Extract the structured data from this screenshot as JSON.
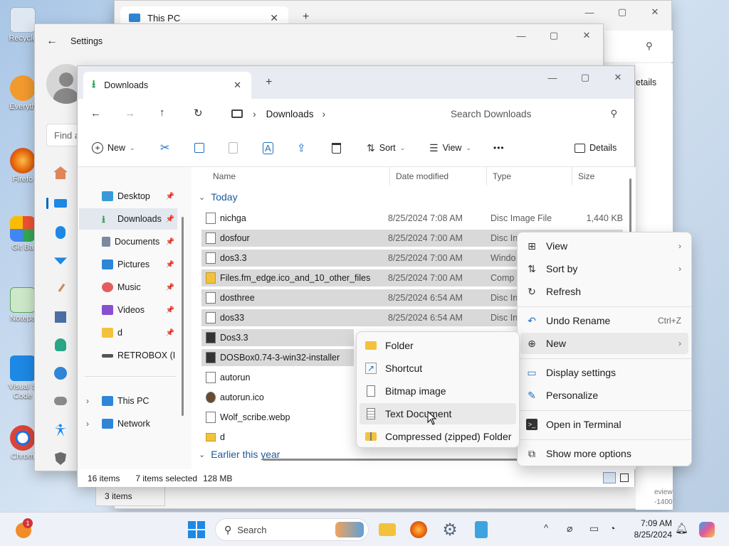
{
  "desktop": {
    "icons": [
      {
        "label": "Recycle",
        "color": "#4a90d9"
      },
      {
        "label": "Everyth",
        "color": "#f29a2e"
      },
      {
        "label": "Firefo",
        "color": "#e66000"
      },
      {
        "label": "Git Ba",
        "color": "#f05133"
      },
      {
        "label": "Notepa",
        "color": "#58a55c"
      },
      {
        "label": "Visual S Code",
        "color": "#1e88e5"
      },
      {
        "label": "Chrom",
        "color": "#1a73e8"
      }
    ]
  },
  "back_window": {
    "tab_title": "This PC",
    "search_icon": "search-icon",
    "details_label": "etails",
    "status_items": "3 items",
    "watermark_1": "eview",
    "watermark_2": "-1400"
  },
  "settings": {
    "title": "Settings",
    "search_placeholder": "Find a"
  },
  "explorer": {
    "tab_title": "Downloads",
    "address": {
      "folder": "Downloads"
    },
    "search_placeholder": "Search Downloads",
    "toolbar": {
      "new_label": "New",
      "sort_label": "Sort",
      "view_label": "View",
      "more_label": "•••",
      "details_label": "Details"
    },
    "sidebar": {
      "quick_access": [
        {
          "label": "Desktop",
          "color": "#3a9ad9"
        },
        {
          "label": "Downloads",
          "color": "#2e9e5b"
        },
        {
          "label": "Documents",
          "color": "#7a8aa0"
        },
        {
          "label": "Pictures",
          "color": "#2f86d6"
        },
        {
          "label": "Music",
          "color": "#e45d5d"
        },
        {
          "label": "Videos",
          "color": "#8a4fd1"
        },
        {
          "label": "d",
          "color": "#f3c23c"
        },
        {
          "label": "RETROBOX (I",
          "color": "#555555"
        }
      ],
      "this_pc": "This PC",
      "network": "Network"
    },
    "columns": {
      "name": "Name",
      "date": "Date modified",
      "type": "Type",
      "size": "Size"
    },
    "groups": {
      "today": "Today",
      "earlier": "Earlier this year"
    },
    "files": [
      {
        "name": "nichga",
        "date": "8/25/2024 7:08 AM",
        "type": "Disc Image File",
        "size": "1,440 KB",
        "selected": false
      },
      {
        "name": "dosfour",
        "date": "8/25/2024 7:00 AM",
        "type": "Disc In",
        "size": "",
        "selected": true
      },
      {
        "name": "dos3.3",
        "date": "8/25/2024 7:00 AM",
        "type": "Windo",
        "size": "",
        "selected": true
      },
      {
        "name": "Files.fm_edge.ico_and_10_other_files",
        "date": "8/25/2024 7:00 AM",
        "type": "Comp",
        "size": "",
        "selected": true
      },
      {
        "name": "dosthree",
        "date": "8/25/2024 6:54 AM",
        "type": "Disc In",
        "size": "",
        "selected": true
      },
      {
        "name": "dos33",
        "date": "8/25/2024 6:54 AM",
        "type": "Disc In",
        "size": "",
        "selected": true
      },
      {
        "name": "Dos3.3",
        "date": "",
        "type": "",
        "size": "",
        "selected": true
      },
      {
        "name": "DOSBox0.74-3-win32-installer",
        "date": "",
        "type": "",
        "size": "",
        "selected": true
      },
      {
        "name": "autorun",
        "date": "",
        "type": "",
        "size": "",
        "selected": false
      },
      {
        "name": "autorun.ico",
        "date": "",
        "type": "",
        "size": "",
        "selected": false
      },
      {
        "name": "Wolf_scribe.webp",
        "date": "",
        "type": "",
        "size": "",
        "selected": false
      },
      {
        "name": "d",
        "date": "",
        "type": "",
        "size": "",
        "selected": false
      }
    ],
    "status": {
      "count": "16 items",
      "selected": "7 items selected",
      "size": "128 MB"
    }
  },
  "context_menu": {
    "items": [
      {
        "label": "View",
        "icon": "grid-icon",
        "submenu": true
      },
      {
        "label": "Sort by",
        "icon": "sort-icon",
        "submenu": true
      },
      {
        "label": "Refresh",
        "icon": "refresh-icon"
      },
      {
        "label": "Undo Rename",
        "icon": "undo-icon",
        "accelerator": "Ctrl+Z"
      },
      {
        "label": "New",
        "icon": "plus-circle-icon",
        "submenu": true
      },
      {
        "label": "Display settings",
        "icon": "display-icon"
      },
      {
        "label": "Personalize",
        "icon": "brush-icon"
      },
      {
        "label": "Open in Terminal",
        "icon": "terminal-icon"
      },
      {
        "label": "Show more options",
        "icon": "more-options-icon"
      }
    ]
  },
  "new_submenu": {
    "items": [
      {
        "label": "Folder",
        "icon": "folder-icon"
      },
      {
        "label": "Shortcut",
        "icon": "shortcut-icon"
      },
      {
        "label": "Bitmap image",
        "icon": "bitmap-icon"
      },
      {
        "label": "Text Document",
        "icon": "text-document-icon"
      },
      {
        "label": "Compressed (zipped) Folder",
        "icon": "zip-folder-icon"
      }
    ]
  },
  "taskbar": {
    "search_label": "Search",
    "time": "7:09 AM",
    "date": "8/25/2024",
    "badge": "1"
  },
  "colors": {
    "accent": "#0067c0",
    "selection": "#d9d9d9",
    "folder": "#f3c23c"
  }
}
